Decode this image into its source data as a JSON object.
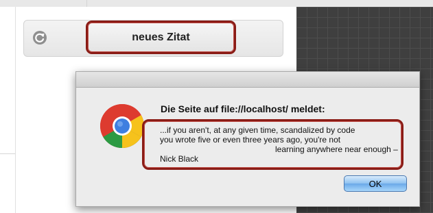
{
  "toolbar": {
    "new_quote_label": "neues Zitat"
  },
  "dialog": {
    "heading": "Die Seite auf file://localhost/ meldet:",
    "message_lines": [
      "...if you aren't, at any given time, scandalized by code",
      "you wrote five or even three years ago, you're not",
      "learning anywhere near enough –",
      "Nick Black"
    ],
    "ok_label": "OK"
  },
  "icons": {
    "refresh": "refresh-icon",
    "browser_logo": "chrome-logo-icon"
  },
  "colors": {
    "highlight_border": "#8a1c16",
    "ok_button": "#7fb8ef"
  }
}
